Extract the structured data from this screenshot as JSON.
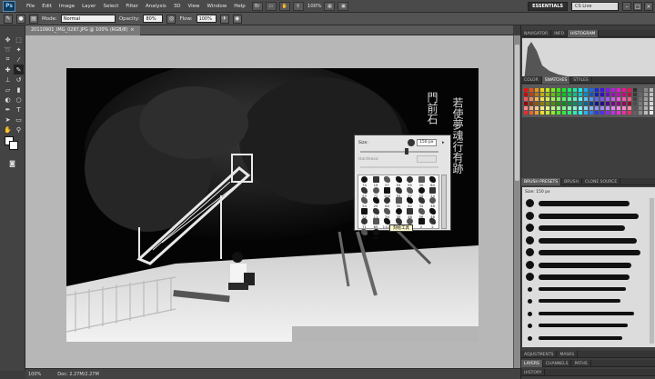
{
  "app": {
    "logo": "Ps",
    "essentials_label": "ESSENTIALS",
    "cs_live_label": "CS Live"
  },
  "menus": [
    "File",
    "Edit",
    "Image",
    "Layer",
    "Select",
    "Filter",
    "Analysis",
    "3D",
    "View",
    "Window",
    "Help"
  ],
  "menubar": {
    "zoom": "100%"
  },
  "options": {
    "mode_label": "Mode:",
    "mode_value": "Normal",
    "opacity_label": "Opacity:",
    "opacity_value": "80%",
    "flow_label": "Flow:",
    "flow_value": "100%"
  },
  "document": {
    "tab_title": "20110901_IMG_0287.JPG @ 100% (RGB/8)",
    "close_icon": "×"
  },
  "status": {
    "zoom": "100%",
    "doc_size": "Doc: 2.27M/2.27M"
  },
  "brush_popup": {
    "size_label": "Size:",
    "size_value": "150 px",
    "hardness_label": "Hardness:",
    "cells": [
      "74",
      "19",
      "57",
      "55",
      "95",
      "20",
      "84",
      "53",
      "72",
      "100",
      "55",
      "27",
      "25",
      "24",
      "24",
      "25",
      "64",
      "30",
      "42",
      "32",
      "48",
      "32",
      "11",
      "34",
      "35",
      "46",
      "56",
      "48",
      "71",
      "65",
      "1125",
      "1",
      "2",
      "2",
      "2",
      "2",
      "15"
    ],
    "tooltip": "刻绘工具"
  },
  "panels": {
    "top_tabs": [
      "NAVIGATOR",
      "INFO",
      "HISTOGRAM"
    ],
    "color_tabs": [
      "COLOR",
      "SWATCHES",
      "STYLES"
    ],
    "brush_tabs": [
      "BRUSH PRESETS",
      "BRUSH",
      "CLONE SOURCE"
    ],
    "preset_size": "Size:   150 px",
    "adjustments_tabs": [
      "ADJUSTMENTS",
      "MASKS"
    ],
    "layers_tabs": [
      "LAYERS",
      "CHANNELS",
      "PATHS"
    ],
    "history_tab": "HISTORY"
  },
  "photo": {
    "calligraphy_right": "若使夢魂行有跡",
    "calligraphy_left": "門前石"
  }
}
